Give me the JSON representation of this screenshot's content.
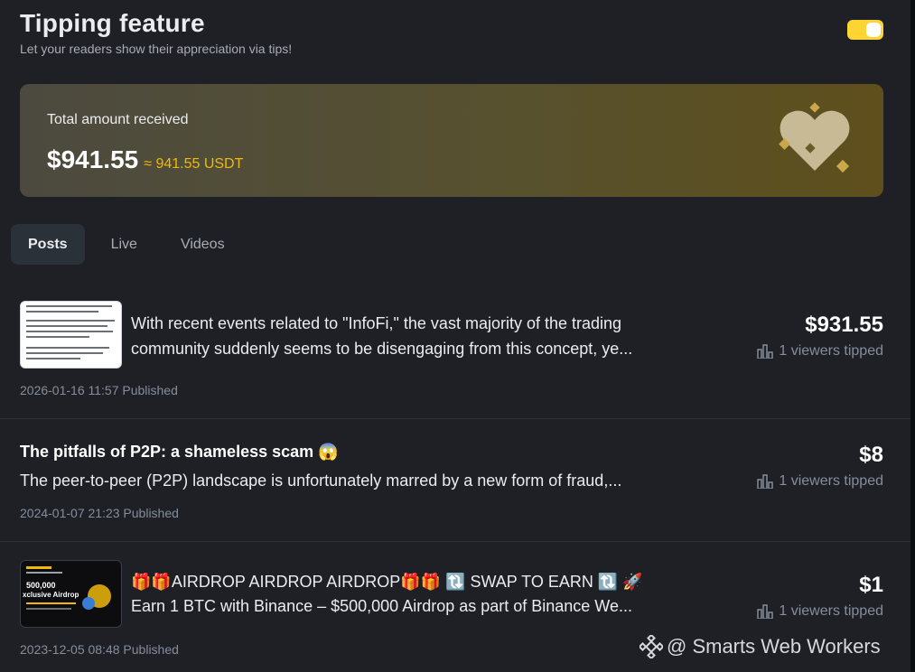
{
  "header": {
    "title": "Tipping feature",
    "subtitle": "Let your readers show their appreciation via tips!",
    "toggle_on": true
  },
  "summary": {
    "label": "Total amount received",
    "amount_usd": "$941.55",
    "amount_usdt": "≈ 941.55 USDT"
  },
  "tabs": [
    {
      "label": "Posts",
      "active": true
    },
    {
      "label": "Live",
      "active": false
    },
    {
      "label": "Videos",
      "active": false
    }
  ],
  "posts": [
    {
      "title": "",
      "description": "With recent events related to \"InfoFi,\" the vast majority of the trading community suddenly seems to be disengaging from this concept, ye...",
      "date": "2026-01-16 11:57 Published",
      "amount": "$931.55",
      "viewers": "1 viewers tipped"
    },
    {
      "title": "The pitfalls of P2P: a shameless scam 😱",
      "description": "The peer-to-peer (P2P) landscape is unfortunately marred by a new form of fraud,...",
      "date": "2024-01-07 21:23 Published",
      "amount": "$8",
      "viewers": "1 viewers tipped"
    },
    {
      "title": "🎁🎁AIRDROP AIRDROP AIRDROP🎁🎁 🔃 SWAP TO EARN 🔃 🚀",
      "description": "Earn 1 BTC with Binance – $500,000 Airdrop as part of Binance We...",
      "date": "2023-12-05 08:48 Published",
      "amount": "$1",
      "viewers": "1 viewers tipped",
      "thumb_text": [
        "500,000",
        "xclusive Airdrop"
      ]
    }
  ],
  "watermark": "@ Smarts Web Workers",
  "colors": {
    "background": "#1e2026",
    "accent": "#fcd535",
    "usdt": "#f0b90b"
  }
}
